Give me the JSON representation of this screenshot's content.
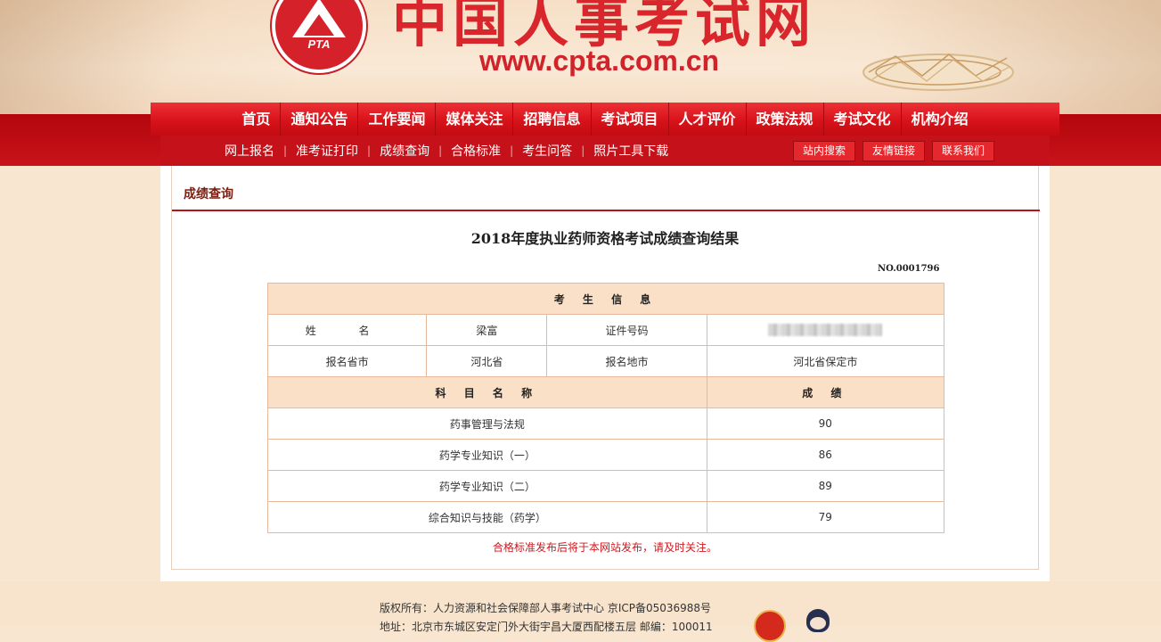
{
  "header": {
    "logo_text": "PTA",
    "site_title": "中国人事考试网",
    "site_url": "www.cpta.com.cn"
  },
  "main_nav": [
    "首页",
    "通知公告",
    "工作要闻",
    "媒体关注",
    "招聘信息",
    "考试项目",
    "人才评价",
    "政策法规",
    "考试文化",
    "机构介绍"
  ],
  "sub_nav": [
    "网上报名",
    "准考证打印",
    "成绩查询",
    "合格标准",
    "考生问答",
    "照片工具下载"
  ],
  "sub_nav_buttons": [
    "站内搜索",
    "友情链接",
    "联系我们"
  ],
  "panel": {
    "title": "成绩查询",
    "result_title": "2018年度执业药师资格考试成绩查询结果",
    "serial_no": "NO.0001796"
  },
  "candidate": {
    "section_header": "考 生 信 息",
    "name_label": "姓 名",
    "name_value": "梁富",
    "id_label": "证件号码",
    "id_value": "",
    "province_label": "报名省市",
    "province_value": "河北省",
    "city_label": "报名地市",
    "city_value": "河北省保定市"
  },
  "scores": {
    "subject_header": "科 目 名 称",
    "score_header": "成 绩",
    "rows": [
      {
        "subject": "药事管理与法规",
        "score": "90"
      },
      {
        "subject": "药学专业知识（一）",
        "score": "86"
      },
      {
        "subject": "药学专业知识（二）",
        "score": "89"
      },
      {
        "subject": "综合知识与技能（药学）",
        "score": "79"
      }
    ]
  },
  "notice": "合格标准发布后将于本网站发布，请及时关注。",
  "footer": {
    "copyright": "版权所有：人力资源和社会保障部人事考试中心 京ICP备05036988号",
    "address": "地址：北京市东城区安定门外大街宇昌大厦西配楼五层 邮编：100011"
  },
  "icons": {
    "emblem": "government-emblem-icon",
    "police": "cyber-police-icon"
  },
  "colors": {
    "brand_red": "#d8262c",
    "nav_red": "#d8121a",
    "table_header_bg": "#fae0c6",
    "table_border": "#e6b99c"
  }
}
